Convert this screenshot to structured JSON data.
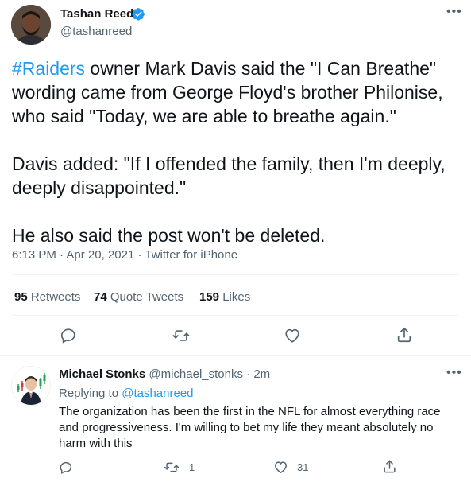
{
  "tweet": {
    "author_name": "Tashan Reed",
    "author_handle": "@tashanreed",
    "hashtag": "#Raiders",
    "para1_rest": " owner Mark Davis said the \"I Can Breathe\" wording came from George Floyd's brother Philonise, who said \"Today, we are able to breathe again.\"",
    "para2": "Davis added: \"If I offended the family, then I'm deeply, deeply disappointed.\"",
    "para3": "He also said the post won't be deleted.",
    "time": "6:13 PM",
    "sep": " · ",
    "date": "Apr 20, 2021",
    "source": "Twitter for iPhone",
    "retweets_count": "95",
    "retweets_label": "Retweets",
    "quotes_count": "74",
    "quotes_label": "Quote Tweets",
    "likes_count": "159",
    "likes_label": "Likes"
  },
  "reply": {
    "author_name": "Michael Stonks",
    "author_handle": "@michael_stonks",
    "sep": " · ",
    "time_ago": "2m",
    "replying_label": "Replying to",
    "replying_to": "@tashanreed",
    "text": "The organization has been the first in the NFL for almost everything race and progressiveness. I'm willing to bet my life they meant absolutely no harm with this",
    "retweet_count": "1",
    "like_count": "31"
  },
  "icons": [
    "verified-badge-icon",
    "more-icon",
    "reply-icon",
    "retweet-icon",
    "like-icon",
    "share-icon"
  ],
  "colors": {
    "accent": "#1d9bf0",
    "text": "#0f1419",
    "muted": "#536471",
    "divider": "#eff3f4"
  }
}
